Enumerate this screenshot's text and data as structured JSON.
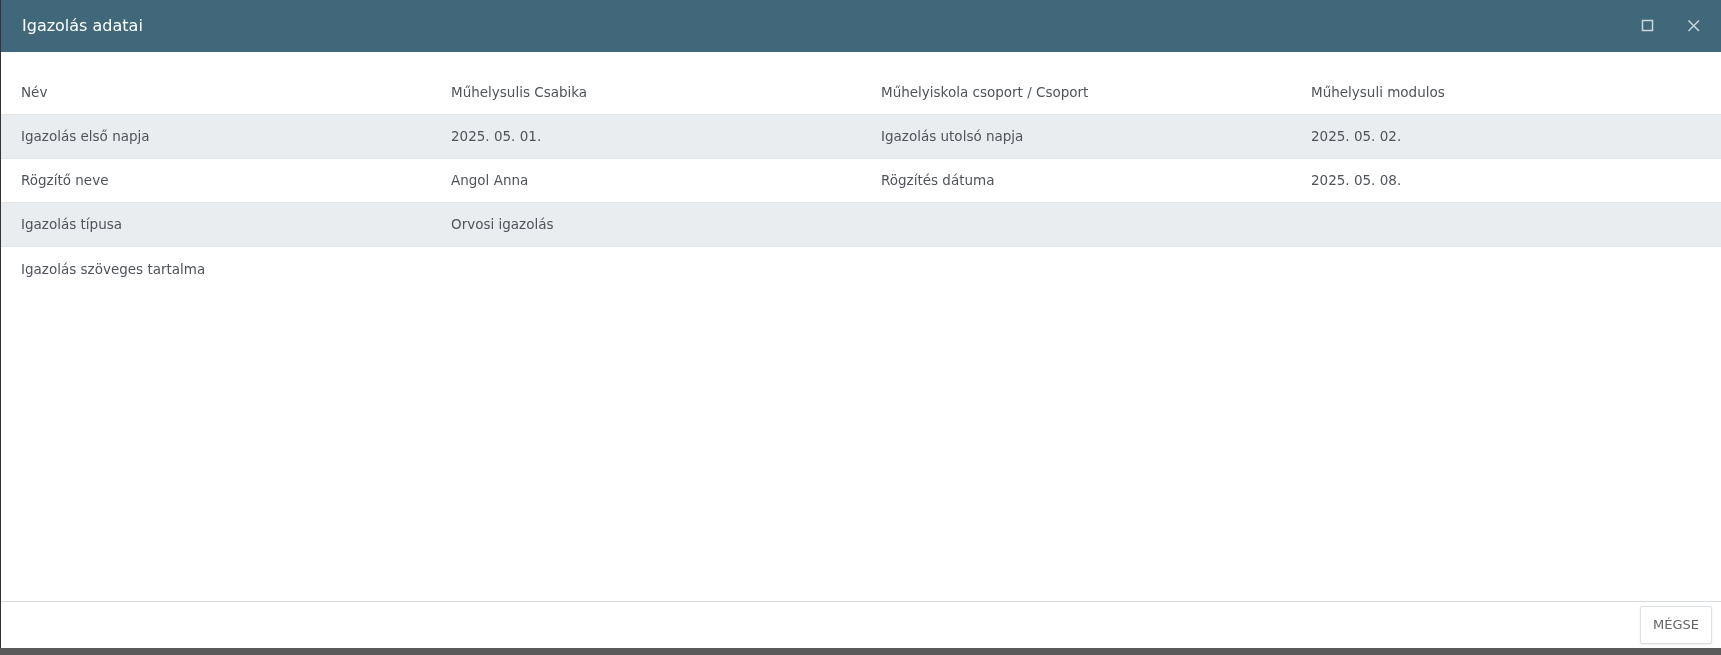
{
  "window": {
    "title": "Igazolás adatai",
    "buttons": [
      {
        "kind": "maximize"
      },
      {
        "kind": "close"
      }
    ]
  },
  "rows": [
    {
      "cells": [
        "Név",
        "Műhelysulis Csabika",
        "Műhelyiskola csoport / Csoport",
        "Műhelysuli modulos"
      ]
    },
    {
      "cells": [
        "Igazolás első napja",
        "2025. 05. 01.",
        "Igazolás utolsó napja",
        "2025. 05. 02."
      ]
    },
    {
      "cells": [
        "Rögzítő neve",
        "Angol Anna",
        "Rögzítés dátuma",
        "2025. 05. 08."
      ]
    },
    {
      "cells": [
        "Igazolás típusa",
        "Orvosi igazolás"
      ]
    },
    {
      "cells": [
        "Igazolás szöveges tartalma"
      ]
    }
  ],
  "footer": {
    "buttons": [
      "MÉGSE"
    ]
  }
}
